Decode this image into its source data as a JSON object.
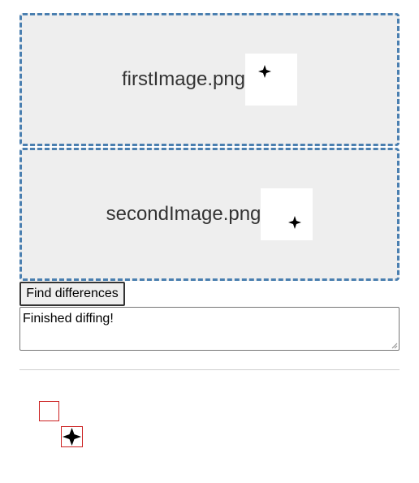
{
  "dropzones": [
    {
      "file_name": "firstImage.png"
    },
    {
      "file_name": "secondImage.png"
    }
  ],
  "find_button": {
    "label": "Find differences"
  },
  "status": {
    "text": "Finished diffing!"
  },
  "icons": {
    "sparkle": "sparkle-icon",
    "diff_sparkle": "diff-sparkle-icon"
  },
  "colors": {
    "dropzone_border": "#4a7fb0",
    "dropzone_bg": "#eeeeee",
    "diff_box_border": "#cc2222"
  }
}
